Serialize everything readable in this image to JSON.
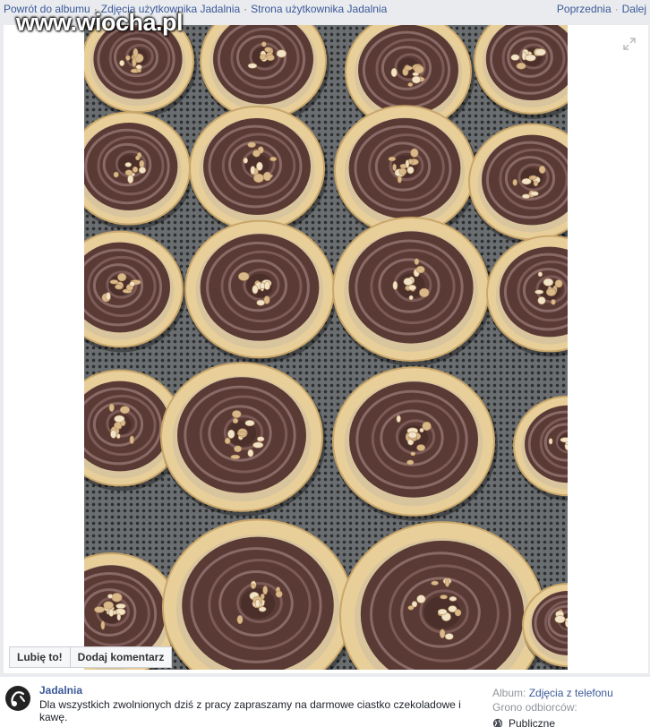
{
  "nav": {
    "back_to_album": "Powrót do albumu",
    "user_photos": "Zdjęcia użytkownika Jadalnia",
    "user_page": "Strona użytkownika Jadalnia",
    "separator": "·",
    "previous": "Poprzednia",
    "next": "Dalej"
  },
  "watermark": "www.wiocha.pl",
  "actions": {
    "like": "Lubię to!",
    "comment": "Dodaj komentarz"
  },
  "post": {
    "author": "Jadalnia",
    "caption": "Dla wszystkich zwolnionych dziś z pracy zapraszamy na darmowe ciastko czekoladowe i kawę."
  },
  "meta": {
    "album_label": "Album:",
    "album_value": "Zdjęcia z telefonu",
    "audience_label": "Grono odbiorców:",
    "audience_value": "Publiczne"
  },
  "colors": {
    "link": "#3b5998",
    "chocolate": "#5a3a35",
    "crust": "#e8cf9a",
    "tray": "#6b6e70"
  },
  "icons": [
    "expand-icon",
    "globe-icon",
    "avatar-logo"
  ]
}
